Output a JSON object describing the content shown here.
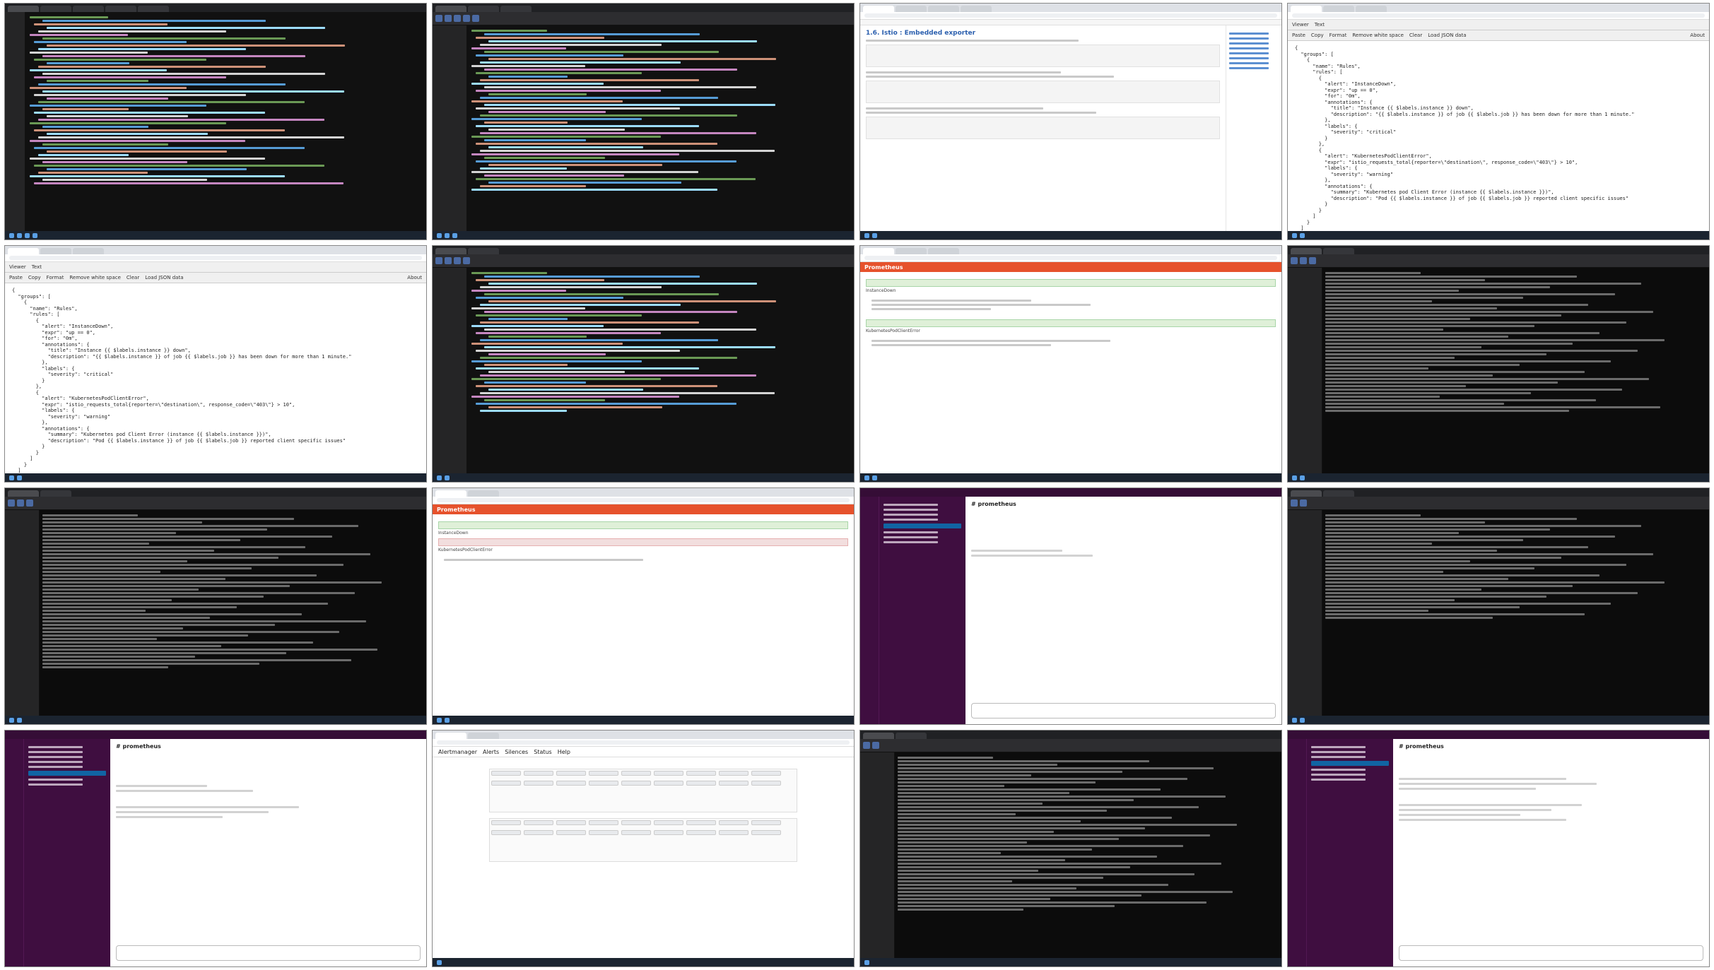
{
  "tiles": {
    "t3": {
      "heading": "1.6. Istio : Embedded exporter"
    },
    "t4": {
      "menu": [
        "Viewer",
        "Text"
      ],
      "actions": [
        "Paste",
        "Copy",
        "Format",
        "Remove white space",
        "Clear",
        "Load JSON data"
      ],
      "about": "About",
      "json": "{\n  \"groups\": [\n    {\n      \"name\": \"Rules\",\n      \"rules\": [\n        {\n          \"alert\": \"InstanceDown\",\n          \"expr\": \"up == 0\",\n          \"for\": \"0m\",\n          \"annotations\": {\n            \"title\": \"Instance {{ $labels.instance }} down\",\n            \"description\": \"{{ $labels.instance }} of job {{ $labels.job }} has been down for more than 1 minute.\"\n          },\n          \"labels\": {\n            \"severity\": \"critical\"\n          }\n        },\n        {\n          \"alert\": \"KubernetesPodClientError\",\n          \"expr\": \"istio_requests_total{reporter=\\\"destination\\\", response_code=\\\"403\\\"} > 10\",\n          \"labels\": {\n            \"severity\": \"warning\"\n          },\n          \"annotations\": {\n            \"summary\": \"Kubernetes pod Client Error (instance {{ $labels.instance }})\",\n            \"description\": \"Pod {{ $labels.instance }} of job {{ $labels.job }} reported client specific issues\"\n          }\n        }\n      ]\n    }\n  ]\n}"
    },
    "t5": {
      "menu": [
        "Viewer",
        "Text"
      ],
      "actions": [
        "Paste",
        "Copy",
        "Format",
        "Remove white space",
        "Clear",
        "Load JSON data"
      ],
      "about": "About"
    },
    "t7": {
      "app": "Prometheus",
      "rule_title": "InstanceDown",
      "rule_title_2": "KubernetesPodClientError"
    },
    "t10": {
      "app": "Prometheus",
      "rule_title": "InstanceDown",
      "rule_title_2": "KubernetesPodClientError"
    },
    "t11": {
      "channel": "# prometheus"
    },
    "t13": {
      "channel": "# prometheus"
    },
    "t14": {
      "app": "Alertmanager",
      "nav": [
        "Alerts",
        "Silences",
        "Status",
        "Help"
      ]
    },
    "t16": {
      "channel": "# prometheus"
    }
  }
}
